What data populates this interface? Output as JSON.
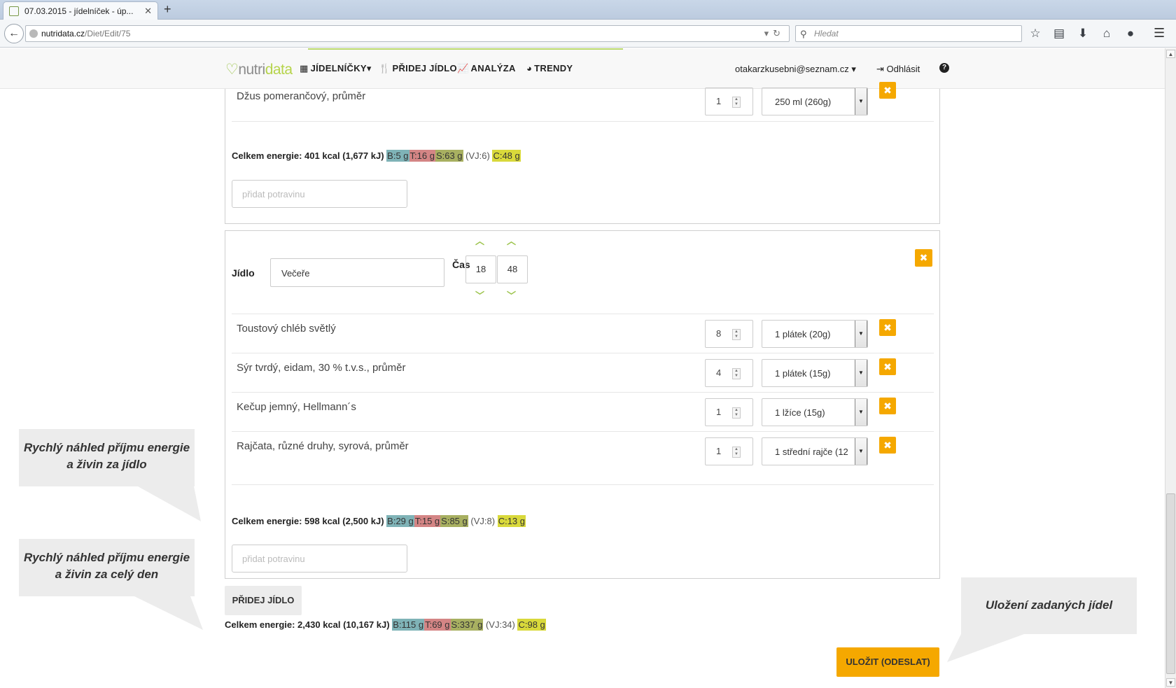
{
  "browser": {
    "tab_title": "07.03.2015 - jídelníček - úp...",
    "url_host": "nutridata.cz",
    "url_path": "/Diet/Edit/75",
    "search_placeholder": "Hledat"
  },
  "header": {
    "logo_nutri": "nutri",
    "logo_data": "data",
    "nav": {
      "jidelnicky": "JÍDELNÍČKY",
      "pridej_jidlo": "PŘIDEJ JÍDLO",
      "analyza": "ANALÝZA",
      "trendy": "TRENDY"
    },
    "user_email": "otakarzkusebni@seznam.cz",
    "logout": "Odhlásit"
  },
  "meal1": {
    "partial_item": {
      "name": "Džus pomerančový, průměr",
      "qty": "1",
      "unit": "250 ml (260g)"
    },
    "energy_label": "Celkem energie: 401 kcal (1,677 kJ)",
    "nutrients": {
      "b": "B:5 g",
      "t": "T:16 g",
      "s": "S:63 g",
      "vj": "(VJ:6)",
      "c": "C:48 g"
    },
    "add_placeholder": "přidat potravinu"
  },
  "meal2": {
    "label_jidlo": "Jídlo",
    "name_value": "Večeře",
    "label_cas": "Čas",
    "hour": "18",
    "minute": "48",
    "items": [
      {
        "name": "Toustový chléb světlý",
        "qty": "8",
        "unit": "1 plátek (20g)"
      },
      {
        "name": "Sýr tvrdý, eidam, 30 % t.v.s., průměr",
        "qty": "4",
        "unit": "1 plátek (15g)"
      },
      {
        "name": "Kečup jemný, Hellmann´s",
        "qty": "1",
        "unit": "1 lžíce (15g)"
      },
      {
        "name": "Rajčata, různé druhy, syrová, průměr",
        "qty": "1",
        "unit": "1 střední rajče (12"
      }
    ],
    "energy_label": "Celkem energie: 598 kcal (2,500 kJ)",
    "nutrients": {
      "b": "B:29 g",
      "t": "T:15 g",
      "s": "S:85 g",
      "vj": "(VJ:8)",
      "c": "C:13 g"
    },
    "add_placeholder": "přidat potravinu"
  },
  "footer": {
    "add_meal": "PŘIDEJ JÍDLO",
    "energy_label": "Celkem energie: 2,430 kcal (10,167 kJ)",
    "nutrients": {
      "b": "B:115 g",
      "t": "T:69 g",
      "s": "S:337 g",
      "vj": "(VJ:34)",
      "c": "C:98 g"
    },
    "save": "ULOŽIT (ODESLAT)"
  },
  "callouts": {
    "meal_line1": "Rychlý náhled příjmu energie",
    "meal_line2": "a živin za jídlo",
    "day_line1": "Rychlý náhled příjmu energie",
    "day_line2": "a živin za celý den",
    "save_text": "Uložení zadaných jídel"
  },
  "colors": {
    "accent_orange": "#f5a800",
    "brand_green": "#9bc34a",
    "protein": "#7fb3b7",
    "fat": "#d48585",
    "saccharides": "#a8b061",
    "fiber": "#d9d93b"
  }
}
